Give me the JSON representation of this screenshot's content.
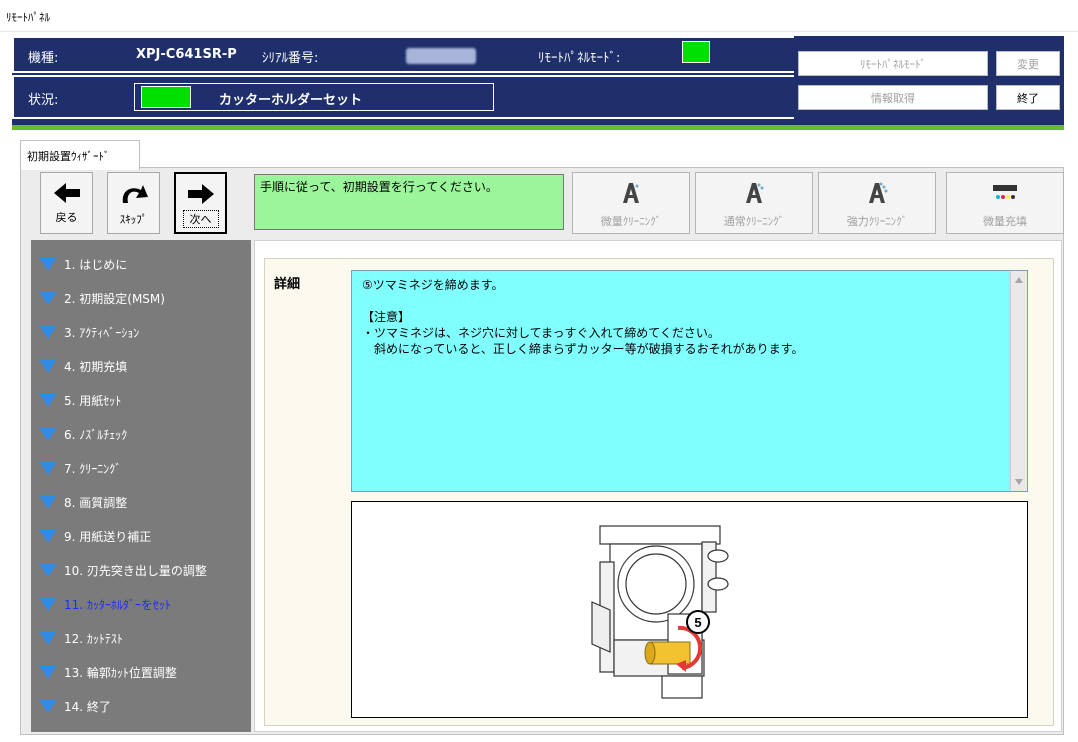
{
  "window": {
    "title": "ﾘﾓｰﾄﾊﾟﾈﾙ"
  },
  "header": {
    "model_label": "機種:",
    "model_value": "XPJ-C641SR-P",
    "serial_label": "ｼﾘｱﾙ番号:",
    "remote_mode_label": "ﾘﾓｰﾄﾊﾟﾈﾙﾓｰﾄﾞ:",
    "status_label": "状況:",
    "status_value": "カッターホルダーセット",
    "btn_remote_mode": "ﾘﾓｰﾄﾊﾟﾈﾙﾓｰﾄﾞ",
    "btn_change": "変更",
    "btn_info": "情報取得",
    "btn_exit": "終了",
    "indicator_color": "#00e000",
    "bar_color": "#1f2f6c",
    "stripe_color": "#6bbb2f"
  },
  "tab": {
    "label": "初期設置ｳｨｻﾞｰﾄﾞ"
  },
  "nav": {
    "back": "戻る",
    "skip": "ｽｷｯﾌﾟ",
    "next": "次へ"
  },
  "instruction": "手順に従って、初期設置を行ってください。",
  "tools": {
    "micro_clean": "微量ｸﾘｰﾆﾝｸﾞ",
    "normal_clean": "通常ｸﾘｰﾆﾝｸﾞ",
    "strong_clean": "強力ｸﾘｰﾆﾝｸﾞ",
    "micro_fill": "微量充填"
  },
  "steps": [
    "1. はじめに",
    "2. 初期設定(MSM)",
    "3. ｱｸﾃｨﾍﾞｰｼｮﾝ",
    "4. 初期充填",
    "5. 用紙ｾｯﾄ",
    "6. ﾉｽﾞﾙﾁｪｯｸ",
    "7. ｸﾘｰﾆﾝｸﾞ",
    "8. 画質調整",
    "9. 用紙送り補正",
    "10. 刃先突き出し量の調整",
    "11. ｶｯﾀｰﾎﾙﾀﾞｰをｾｯﾄ",
    "12. ｶｯﾄﾃｽﾄ",
    "13. 輪郭ｶｯﾄ位置調整",
    "14. 終了"
  ],
  "active_step_index": 10,
  "detail": {
    "label": "詳細",
    "line1": "⑤ツマミネジを締めます。",
    "line2": "【注意】",
    "line3": "・ツマミネジは、ネジ穴に対してまっすぐ入れて締めてください。",
    "line4": "　斜めになっていると、正しく締まらずカッター等が破損するおそれがあります。"
  },
  "illustration": {
    "step_number": "5"
  }
}
